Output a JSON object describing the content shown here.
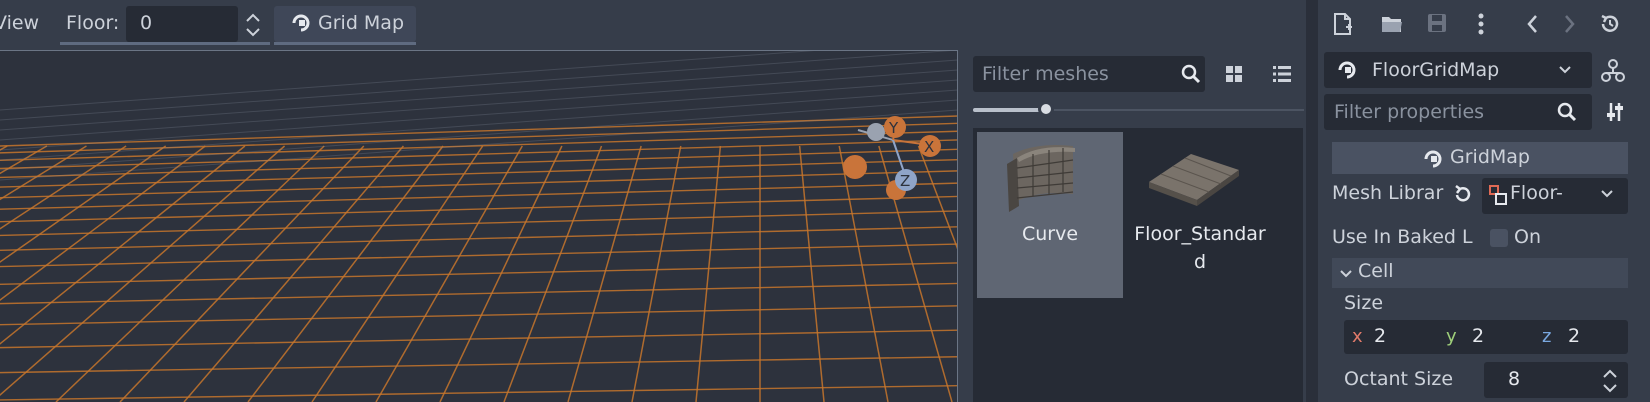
{
  "toolbar": {
    "view_menu": "View",
    "floor_label": "Floor:",
    "floor_value": "0",
    "gridmap_button": "Grid Map"
  },
  "palette": {
    "filter_placeholder": "Filter meshes",
    "zoom_level": 0.22,
    "items": [
      {
        "name": "Curve",
        "selected": true
      },
      {
        "name": "Floor_Standar\nd",
        "selected": false
      }
    ]
  },
  "inspector": {
    "node_name": "FloorGridMap",
    "filter_placeholder": "Filter properties",
    "class_header": "GridMap",
    "mesh_library_label": "Mesh Librar",
    "mesh_library_value": "Floor-",
    "use_in_baked_label": "Use In Baked L",
    "use_in_baked_value": "On",
    "cell_section": "Cell",
    "size_label": "Size",
    "size": {
      "x_label": "x",
      "x": "2",
      "y_label": "y",
      "y": "2",
      "z_label": "z",
      "z": "2"
    },
    "octant_label": "Octant Size",
    "octant_value": "8"
  },
  "gizmo": {
    "y": "Y",
    "x": "X",
    "z": "Z"
  },
  "colors": {
    "background": "#363d4a",
    "field": "#262b35",
    "grid_line": "#c7762c",
    "gizmo_x": "#c9743a",
    "gizmo_z": "#8fa4c8",
    "axis_x": "#e07a6a",
    "axis_y": "#9fd07a",
    "axis_z": "#7aa8e0"
  }
}
